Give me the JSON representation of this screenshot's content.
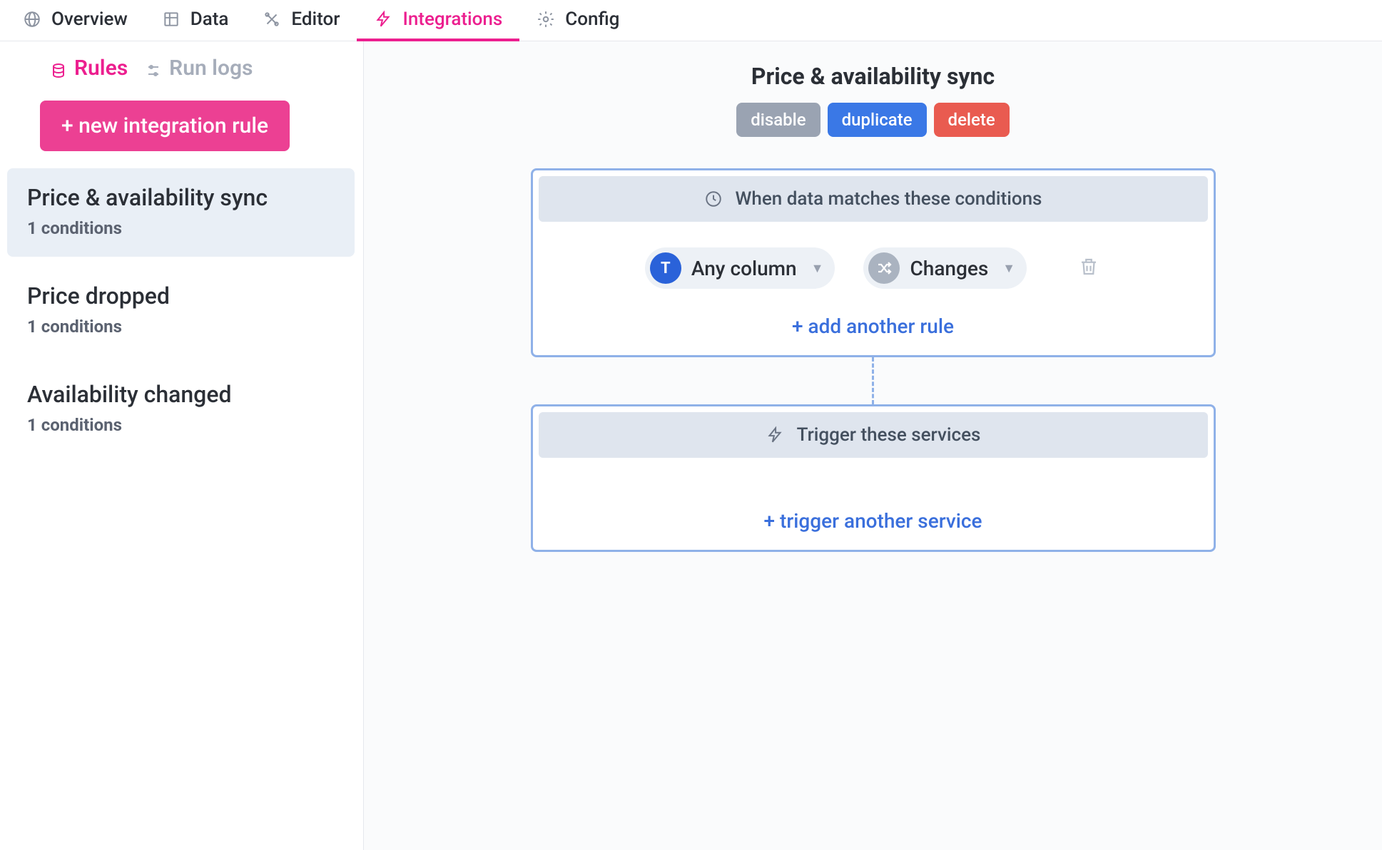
{
  "topnav": {
    "tabs": [
      {
        "label": "Overview"
      },
      {
        "label": "Data"
      },
      {
        "label": "Editor"
      },
      {
        "label": "Integrations"
      },
      {
        "label": "Config"
      }
    ]
  },
  "subnav": {
    "rules": "Rules",
    "runlogs": "Run logs"
  },
  "sidebar": {
    "new_rule_label": "+ new integration rule",
    "rules": [
      {
        "title": "Price & availability sync",
        "sub": "1 conditions"
      },
      {
        "title": "Price dropped",
        "sub": "1 conditions"
      },
      {
        "title": "Availability changed",
        "sub": "1 conditions"
      }
    ]
  },
  "main": {
    "title": "Price & availability sync",
    "actions": {
      "disable": "disable",
      "duplicate": "duplicate",
      "delete": "delete"
    },
    "conditions_header": "When data matches these conditions",
    "column_select": "Any column",
    "column_badge": "T",
    "op_select": "Changes",
    "add_rule": "+ add another rule",
    "services_header": "Trigger these services",
    "add_service": "+ trigger another service"
  }
}
